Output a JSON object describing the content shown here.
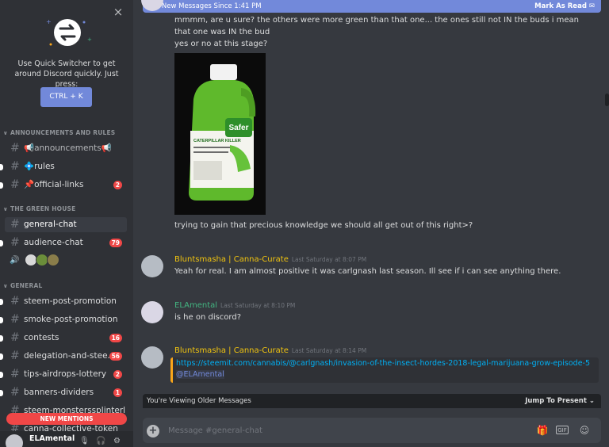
{
  "quick_switcher": {
    "close_glyph": "×",
    "text": "Use Quick Switcher to get around Discord quickly. Just press:",
    "shortcut": "CTRL + K"
  },
  "sidebar": {
    "categories": [
      "ANNOUNCEMENTS AND RULES",
      "THE GREEN HOUSE",
      "GENERAL"
    ],
    "channels": [
      {
        "name": "📢announcements📢",
        "badge": ""
      },
      {
        "name": "💠rules",
        "badge": ""
      },
      {
        "name": "📌official-links",
        "badge": "2"
      },
      {
        "name": "general-chat",
        "badge": ""
      },
      {
        "name": "audience-chat",
        "badge": "79"
      },
      {
        "name": "steem-post-promotion",
        "badge": ""
      },
      {
        "name": "smoke-post-promotion",
        "badge": ""
      },
      {
        "name": "contests",
        "badge": "16"
      },
      {
        "name": "delegation-and-stee...",
        "badge": "56"
      },
      {
        "name": "tips-airdrops-lottery",
        "badge": "2"
      },
      {
        "name": "banners-dividers",
        "badge": "1"
      },
      {
        "name": "steem-monsterssplinterl",
        "badge": ""
      },
      {
        "name": "canna-collective-token",
        "badge": ""
      }
    ],
    "new_mentions": "NEW MENTIONS",
    "user": {
      "name": "ELAmental"
    }
  },
  "main": {
    "new_messages_bar": {
      "text": "198 New Messages Since 1:41 PM",
      "mark_as_read": "Mark As Read"
    },
    "messages": [
      {
        "lines": [
          "mmmm, are u sure? the others were more green than that one... the ones still not IN the buds i mean",
          "that one was IN the bud",
          "yes or no at this stage?"
        ],
        "image_label": "Safer",
        "image_sublabel": "CATERPILLAR KILLER",
        "after_image": "trying to gain that precious knowledge we should all get out of this right>?"
      },
      {
        "author": "Bluntsmasha | Canna-Curate",
        "author_color": "#f1c40f",
        "timestamp": "Last Saturday at 8:07 PM",
        "text": "Yeah for real. I am almost positive it was carlgnash last season. Ill see if i can see anything there."
      },
      {
        "author": "ELAmental",
        "author_color": "#43b581",
        "timestamp": "Last Saturday at 8:10 PM",
        "text": "is he on discord?"
      },
      {
        "author": "Bluntsmasha | Canna-Curate",
        "author_color": "#f1c40f",
        "timestamp": "Last Saturday at 8:14 PM",
        "link": "https://steemit.com/cannabis/@carlgnash/invasion-of-the-insect-hordes-2018-legal-marijuana-grow-episode-5",
        "mention": "@ELAmental"
      }
    ],
    "older_bar": {
      "text": "You're Viewing Older Messages",
      "jump": "Jump To Present"
    },
    "composer": {
      "placeholder": "Message #general-chat"
    }
  }
}
